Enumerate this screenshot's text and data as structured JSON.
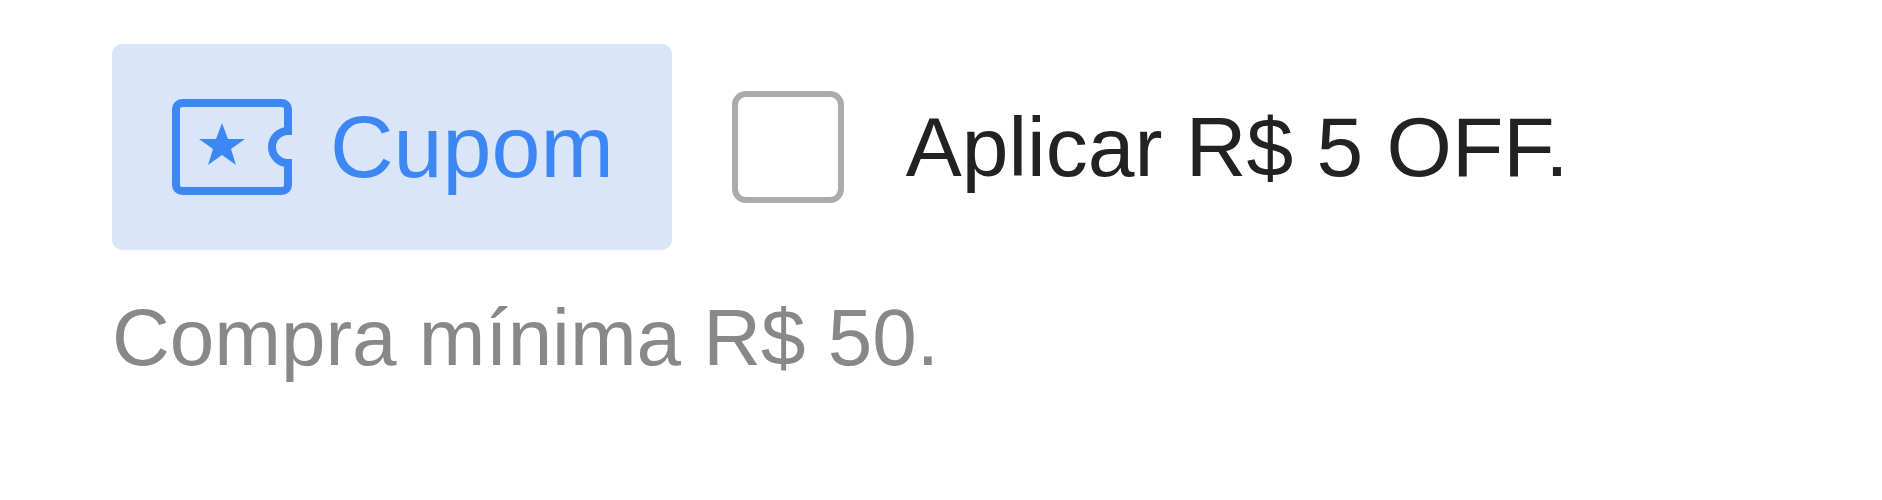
{
  "coupon": {
    "label": "Cupom"
  },
  "apply": {
    "label": "Aplicar R$ 5 OFF.",
    "checked": false
  },
  "note": "Compra mínima R$ 50."
}
